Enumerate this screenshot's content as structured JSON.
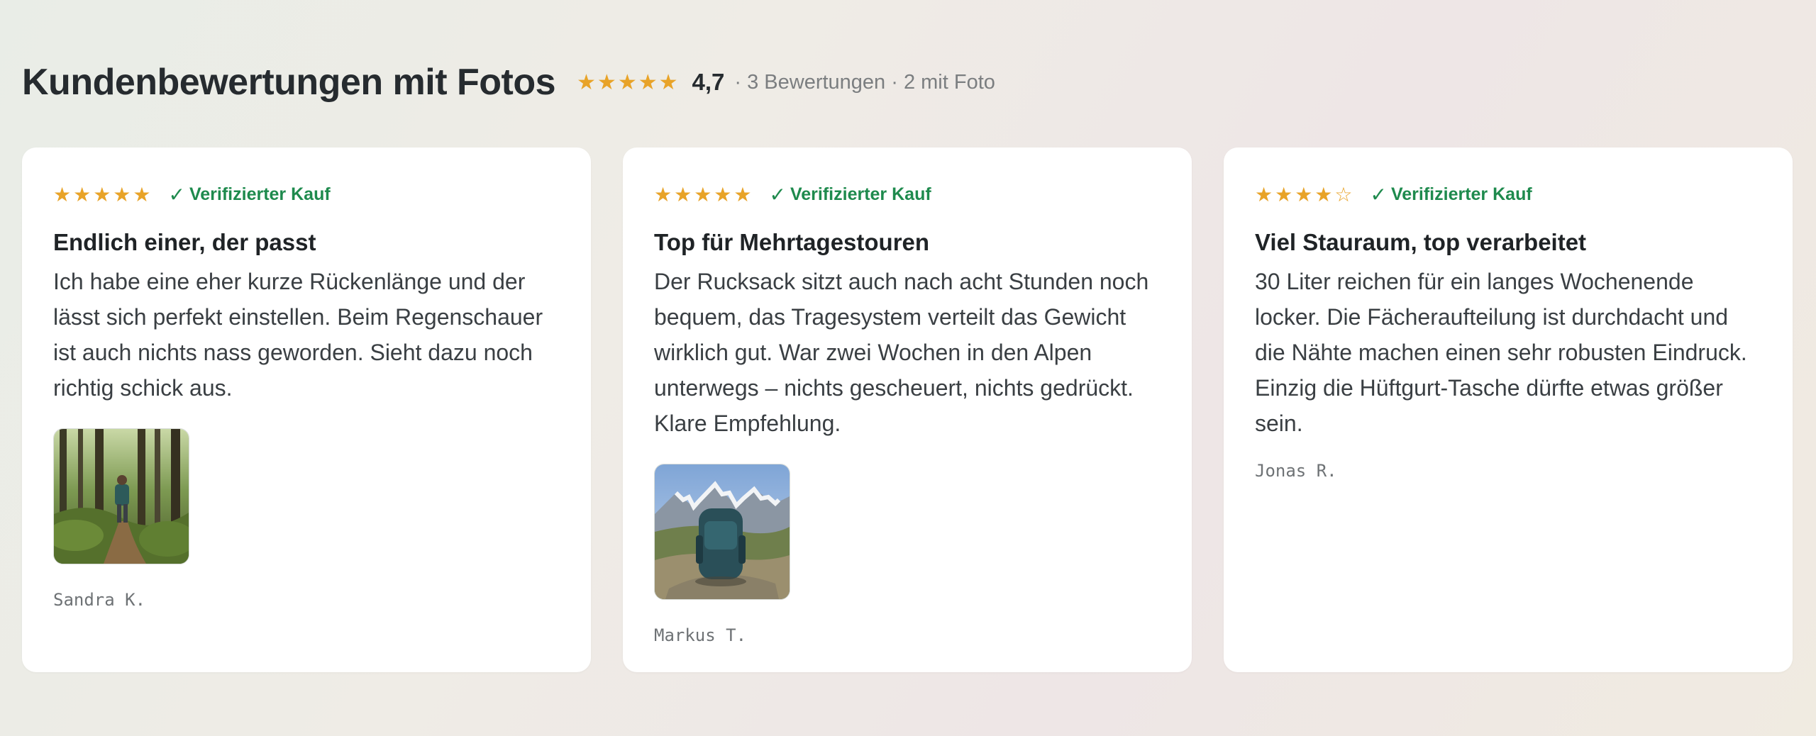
{
  "header": {
    "title": "Kundenbewertungen mit Fotos",
    "stars": "★★★★★",
    "score": "4,7",
    "meta": "· 3 Bewertungen · 2 mit Foto"
  },
  "reviews": [
    {
      "stars": "★★★★★",
      "rating": 5,
      "verified_check": "✓",
      "verified_label": "Verifizierter Kauf",
      "title": "Endlich einer, der passt",
      "text": "Ich habe eine eher kurze Rückenlänge und der lässt sich perfekt einstellen. Beim Regenschauer ist auch nichts nass geworden. Sieht dazu noch richtig schick aus.",
      "photo": "forest-hiker-photo",
      "author": "Sandra K."
    },
    {
      "stars": "★★★★★",
      "rating": 5,
      "verified_check": "✓",
      "verified_label": "Verifizierter Kauf",
      "title": "Top für Mehrtagestouren",
      "text": "Der Rucksack sitzt auch nach acht Stunden noch bequem, das Tragesystem verteilt das Gewicht wirklich gut. War zwei Wochen in den Alpen unterwegs – nichts gescheuert, nichts gedrückt. Klare Empfehlung.",
      "photo": "mountain-backpack-photo",
      "author": "Markus T."
    },
    {
      "stars": "★★★★☆",
      "rating": 4,
      "verified_check": "✓",
      "verified_label": "Verifizierter Kauf",
      "title": "Viel Stauraum, top verarbeitet",
      "text": "30 Liter reichen für ein langes Wochenende locker. Die Fächeraufteilung ist durchdacht und die Nähte machen einen sehr robusten Eindruck. Einzig die Hüftgurt-Tasche dürfte etwas größer sein.",
      "author": "Jonas R."
    }
  ],
  "colors": {
    "star": "#e8a328",
    "verified": "#1e8a4d",
    "title": "#262b2f",
    "meta": "#7b7e80"
  }
}
